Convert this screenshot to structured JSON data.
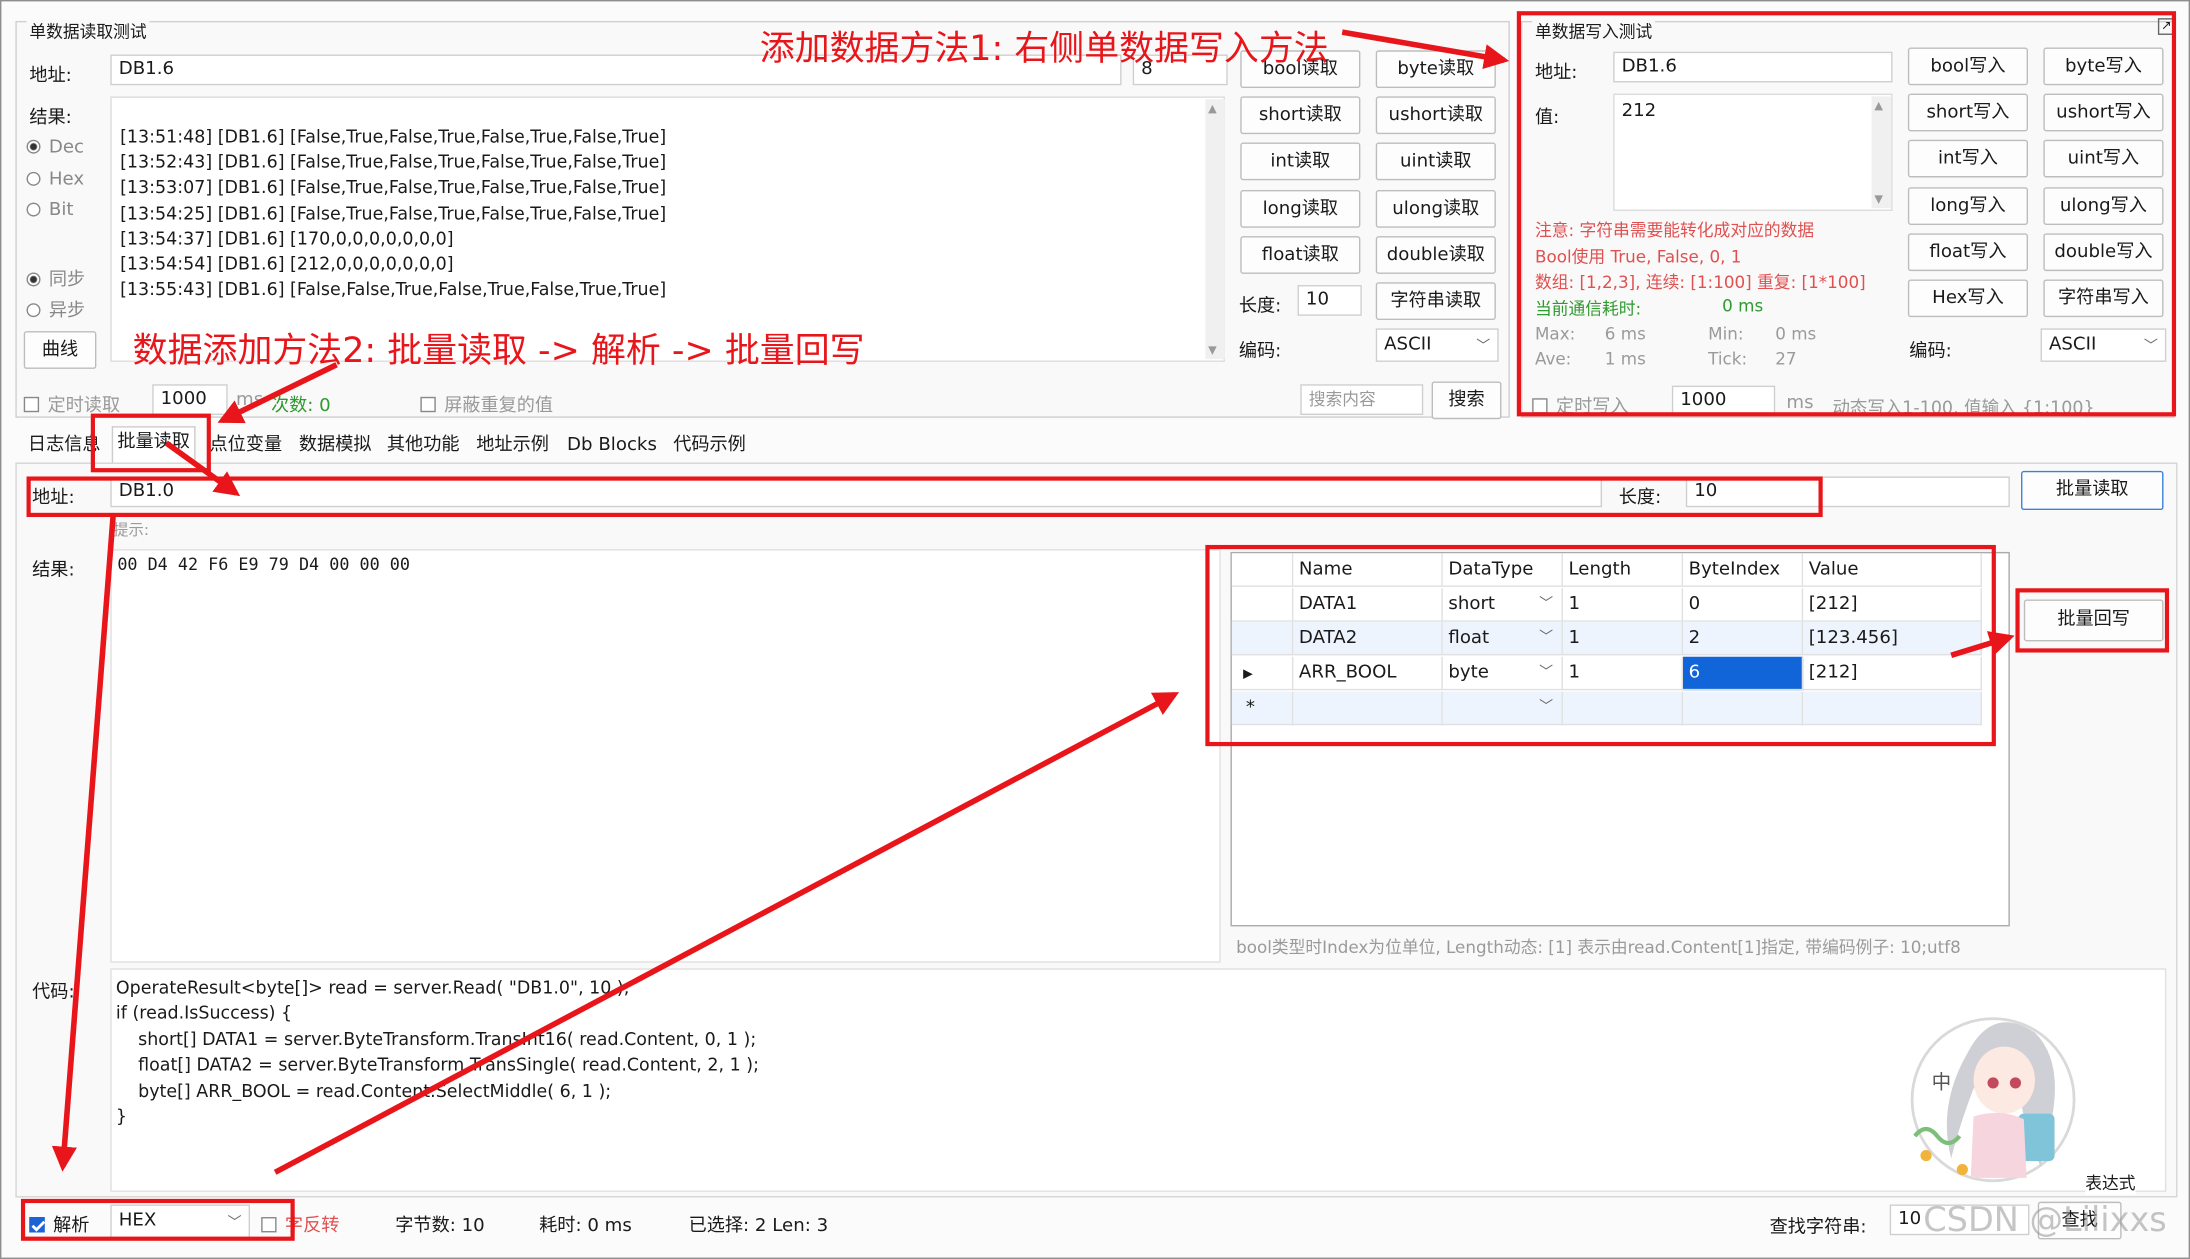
{
  "single_read": {
    "group_title": "单数据读取测试",
    "address_label": "地址:",
    "address_value": "DB1.6",
    "length_value": "8",
    "result_label": "结果:",
    "radio_dec": "Dec",
    "radio_hex": "Hex",
    "radio_bit": "Bit",
    "radio_sync": "同步",
    "radio_async": "异步",
    "curve_button": "曲线",
    "log_lines": [
      "[13:51:48] [DB1.6] [False,True,False,True,False,True,False,True]",
      "[13:52:43] [DB1.6] [False,True,False,True,False,True,False,True]",
      "[13:53:07] [DB1.6] [False,True,False,True,False,True,False,True]",
      "[13:54:25] [DB1.6] [False,True,False,True,False,True,False,True]",
      "[13:54:37] [DB1.6] [170,0,0,0,0,0,0,0]",
      "[13:54:54] [DB1.6] [212,0,0,0,0,0,0,0]",
      "[13:55:43] [DB1.6] [False,False,True,False,True,False,True,True]"
    ],
    "buttons": [
      [
        "bool读取",
        "byte读取"
      ],
      [
        "short读取",
        "ushort读取"
      ],
      [
        "int读取",
        "uint读取"
      ],
      [
        "long读取",
        "ulong读取"
      ],
      [
        "float读取",
        "double读取"
      ]
    ],
    "length_label": "长度:",
    "length_field": "10",
    "string_read_button": "字符串读取",
    "encoding_label": "编码:",
    "encoding_value": "ASCII",
    "timer_read_label": "定时读取",
    "timer_interval": "1000",
    "ms_label": "ms",
    "count_label": "次数: 0",
    "mask_dup_label": "屏蔽重复的值",
    "search_placeholder": "搜索内容",
    "search_button": "搜索"
  },
  "single_write": {
    "group_title": "单数据写入测试",
    "address_label": "地址:",
    "address_value": "DB1.6",
    "value_label": "值:",
    "value_text": "212",
    "note_lines": [
      "注意: 字符串需要能转化成对应的数据",
      "Bool使用 True, False, 0, 1",
      "数组: [1,2,3], 连续: [1:100] 重复: [1*100]"
    ],
    "latency_label": "当前通信耗时:",
    "latency_value": "0 ms",
    "max_label": "Max:",
    "max_value": "6 ms",
    "min_label": "Min:",
    "min_value": "0 ms",
    "ave_label": "Ave:",
    "ave_value": "1 ms",
    "tick_label": "Tick:",
    "tick_value": "27",
    "buttons": [
      [
        "bool写入",
        "byte写入"
      ],
      [
        "short写入",
        "ushort写入"
      ],
      [
        "int写入",
        "uint写入"
      ],
      [
        "long写入",
        "ulong写入"
      ],
      [
        "float写入",
        "double写入"
      ],
      [
        "Hex写入",
        "字符串写入"
      ]
    ],
    "encoding_label": "编码:",
    "encoding_value": "ASCII",
    "timer_write_label": "定时写入",
    "timer_interval": "1000",
    "ms_label": "ms",
    "dynamic_hint": "动态写入1-100, 值输入 {1:100}"
  },
  "tabs": [
    "日志信息",
    "批量读取",
    "点位变量",
    "数据模拟",
    "其他功能",
    "地址示例",
    "Db Blocks",
    "代码示例"
  ],
  "batch": {
    "address_label": "地址:",
    "address_value": "DB1.0",
    "length_label": "长度:",
    "length_value": "10",
    "batch_read_button": "批量读取",
    "hint_label": "提示:",
    "result_label": "结果:",
    "result_value": "00 D4 42 F6 E9 79 D4 00 00 00",
    "write_back_button": "批量回写",
    "grid_headers": [
      "Name",
      "DataType",
      "Length",
      "ByteIndex",
      "Value"
    ],
    "grid_rows": [
      {
        "name": "DATA1",
        "type": "short",
        "length": "1",
        "index": "0",
        "value": "[212]"
      },
      {
        "name": "DATA2",
        "type": "float",
        "length": "1",
        "index": "2",
        "value": "[123.456]"
      },
      {
        "name": "ARR_BOOL",
        "type": "byte",
        "length": "1",
        "index": "6",
        "value": "[212]"
      }
    ],
    "grid_note": "bool类型时Index为位单位, Length动态: [1] 表示由read.Content[1]指定, 带编码例子: 10;utf8",
    "code_label": "代码:",
    "code_lines": [
      "OperateResult<byte[]> read = server.Read( \"DB1.0\", 10 );",
      "if (read.IsSuccess) {",
      "    short[] DATA1 = server.ByteTransform.TransInt16( read.Content, 0, 1 );",
      "    float[] DATA2 = server.ByteTransform.TransSingle( read.Content, 2, 1 );",
      "    byte[] ARR_BOOL = read.Content.SelectMiddle( 6, 1 );",
      "}"
    ],
    "expression_label": "表达式"
  },
  "status": {
    "parse_label": "解析",
    "parse_format": "HEX",
    "reverse_label": "字反转",
    "bytes_label": "字节数: 10",
    "elapsed_label": "耗时: 0 ms",
    "selected_label": "已选择: 2 Len: 3",
    "find_label": "查找字符串:",
    "find_value": "10",
    "find_button": "查找"
  },
  "annotations": {
    "method1": "添加数据方法1: 右侧单数据写入方法",
    "method2": "数据添加方法2: 批量读取 -> 解析 -> 批量回写"
  },
  "watermark": "CSDN @Lilixxs",
  "colors": {
    "annotation_red": "#e8161b",
    "selection_blue": "#1165d8",
    "note_red": "#e05050",
    "status_green": "#2f9a2f"
  }
}
